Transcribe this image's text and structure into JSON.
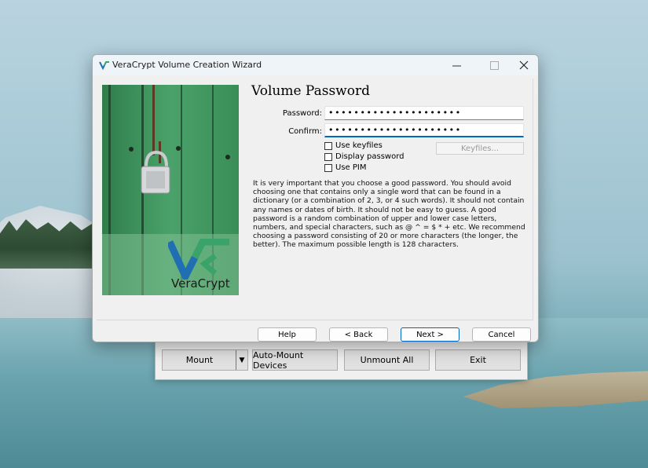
{
  "main_window": {
    "buttons": {
      "mount": "Mount",
      "auto_mount": "Auto-Mount Devices",
      "unmount_all": "Unmount All",
      "exit": "Exit"
    }
  },
  "wizard": {
    "title": "VeraCrypt Volume Creation Wizard",
    "heading": "Volume Password",
    "password_label": "Password:",
    "password_value": "•••••••••••••••••••••",
    "confirm_label": "Confirm:",
    "confirm_value": "•••••••••••••••••••••",
    "checkboxes": {
      "use_keyfiles": "Use keyfiles",
      "display_password": "Display password",
      "use_pim": "Use PIM"
    },
    "keyfiles_button": "Keyfiles...",
    "info_text": "It is very important that you choose a good password. You should avoid choosing one that contains only a single word that can be found in a dictionary (or a combination of 2, 3, or 4 such words). It should not contain any names or dates of birth. It should not be easy to guess. A good password is a random combination of upper and lower case letters, numbers, and special characters, such as @ ^ = $ * + etc. We recommend choosing a password consisting of 20 or more characters (the longer, the better). The maximum possible length is 128 characters.",
    "banner_brand": "VeraCrypt",
    "footer": {
      "help": "Help",
      "back": "< Back",
      "next": "Next >",
      "cancel": "Cancel"
    }
  },
  "colors": {
    "accent": "#0067c0",
    "banner_green": "#3e8f5a",
    "logo_blue": "#1f6fb2",
    "logo_green": "#3aa36a"
  }
}
